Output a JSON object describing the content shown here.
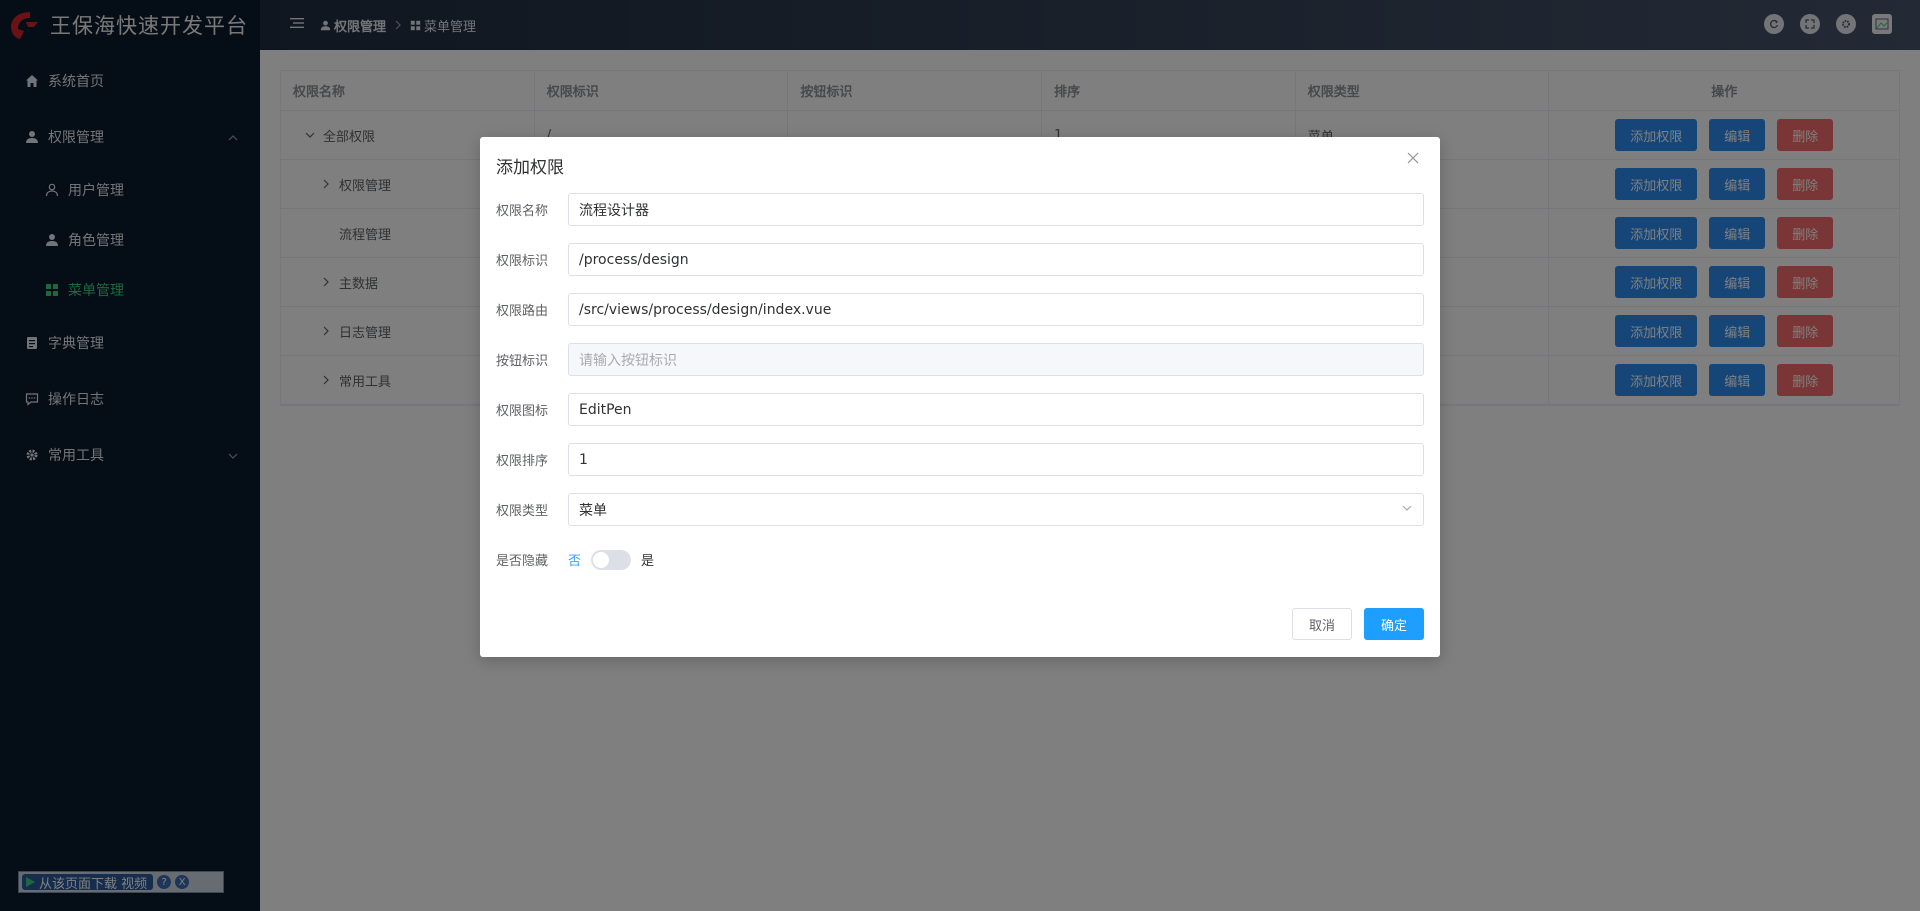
{
  "app": {
    "title": "王保海快速开发平台"
  },
  "sidebar": {
    "items": [
      {
        "label": "系统首页",
        "icon": "home-icon"
      },
      {
        "label": "权限管理",
        "icon": "user-icon",
        "expanded": true,
        "children": [
          {
            "label": "用户管理",
            "icon": "user-outline-icon"
          },
          {
            "label": "角色管理",
            "icon": "user-icon"
          },
          {
            "label": "菜单管理",
            "icon": "grid-icon",
            "active": true
          }
        ]
      },
      {
        "label": "字典管理",
        "icon": "list-icon"
      },
      {
        "label": "操作日志",
        "icon": "chat-icon"
      },
      {
        "label": "常用工具",
        "icon": "gear-icon",
        "expanded": false
      }
    ],
    "active_color": "#3ad07f"
  },
  "download_bar": {
    "label": "从该页面下载 视频",
    "help": "?",
    "close": "X"
  },
  "header": {
    "breadcrumb": [
      "权限管理",
      "菜单管理"
    ]
  },
  "table": {
    "columns": [
      "权限名称",
      "权限标识",
      "按钮标识",
      "排序",
      "权限类型",
      "操作"
    ],
    "rows": [
      {
        "name": "全部权限",
        "mark": "/",
        "button": "",
        "sort": "1",
        "type": "菜单",
        "expand": "open"
      },
      {
        "name": "权限管理",
        "mark": "",
        "button": "",
        "sort": "",
        "type": "",
        "expand": "closed"
      },
      {
        "name": "流程管理",
        "mark": "",
        "button": "",
        "sort": "",
        "type": "",
        "expand": "none"
      },
      {
        "name": "主数据",
        "mark": "",
        "button": "",
        "sort": "",
        "type": "",
        "expand": "closed"
      },
      {
        "name": "日志管理",
        "mark": "",
        "button": "",
        "sort": "",
        "type": "",
        "expand": "closed"
      },
      {
        "name": "常用工具",
        "mark": "",
        "button": "",
        "sort": "",
        "type": "",
        "expand": "closed"
      }
    ],
    "actions": {
      "add": "添加权限",
      "edit": "编辑",
      "delete": "删除"
    },
    "colors": {
      "primary": "#2d8cf0",
      "danger": "#f56c6c"
    }
  },
  "dialog": {
    "title": "添加权限",
    "fields": [
      {
        "label": "权限名称",
        "value": "流程设计器"
      },
      {
        "label": "权限标识",
        "value": "/process/design"
      },
      {
        "label": "权限路由",
        "value": "/src/views/process/design/index.vue"
      },
      {
        "label": "按钮标识",
        "placeholder": "请输入按钮标识",
        "disabled": true
      },
      {
        "label": "权限图标",
        "value": "EditPen"
      },
      {
        "label": "权限排序",
        "value": "1"
      },
      {
        "label": "权限类型",
        "value": "菜单"
      }
    ],
    "hidden": {
      "label": "是否隐藏",
      "off": "否",
      "on": "是",
      "checked": false
    },
    "cancel": "取消",
    "confirm": "确定",
    "confirm_color": "#1e9fff"
  }
}
